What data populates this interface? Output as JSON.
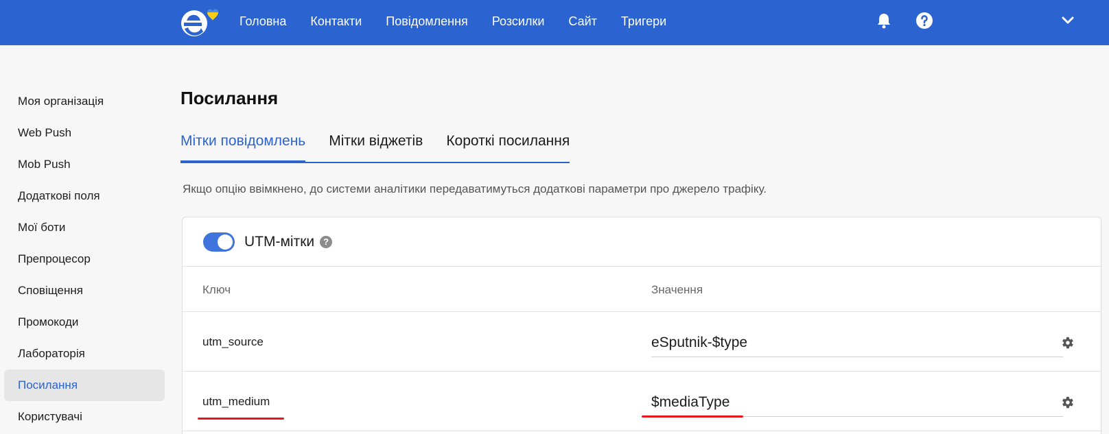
{
  "nav": {
    "items": [
      "Головна",
      "Контакти",
      "Повідомлення",
      "Розсилки",
      "Сайт",
      "Тригери"
    ]
  },
  "icons": {
    "logo": "esputnik-logo-icon",
    "bell": "bell-icon",
    "help": "help-icon",
    "chevron": "chevron-down-icon",
    "gear": "gear-icon"
  },
  "colors": {
    "brand": "#2b63d1",
    "annotation": "#e8161d"
  },
  "sidebar": {
    "items": [
      {
        "label": "Моя організація"
      },
      {
        "label": "Web Push"
      },
      {
        "label": "Mob Push"
      },
      {
        "label": "Додаткові поля"
      },
      {
        "label": "Мої боти"
      },
      {
        "label": "Препроцесор"
      },
      {
        "label": "Сповіщення"
      },
      {
        "label": "Промокоди"
      },
      {
        "label": "Лабораторія"
      },
      {
        "label": "Посилання",
        "active": true
      },
      {
        "label": "Користувачі"
      }
    ]
  },
  "main": {
    "title": "Посилання",
    "tabs": [
      {
        "label": "Мітки повідомлень",
        "active": true
      },
      {
        "label": "Мітки віджетів"
      },
      {
        "label": "Короткі посилання"
      }
    ],
    "description": "Якщо опцію ввімкнено, до системи аналітики передаватимуться додаткові параметри про джерело трафіку."
  },
  "utm": {
    "title": "UTM-мітки",
    "enabled": true,
    "help_glyph": "?",
    "columns": {
      "key": "Ключ",
      "value": "Значення"
    },
    "rows": [
      {
        "key": "utm_source",
        "value": "eSputnik-$type"
      },
      {
        "key": "utm_medium",
        "value": "$mediaType"
      }
    ]
  }
}
